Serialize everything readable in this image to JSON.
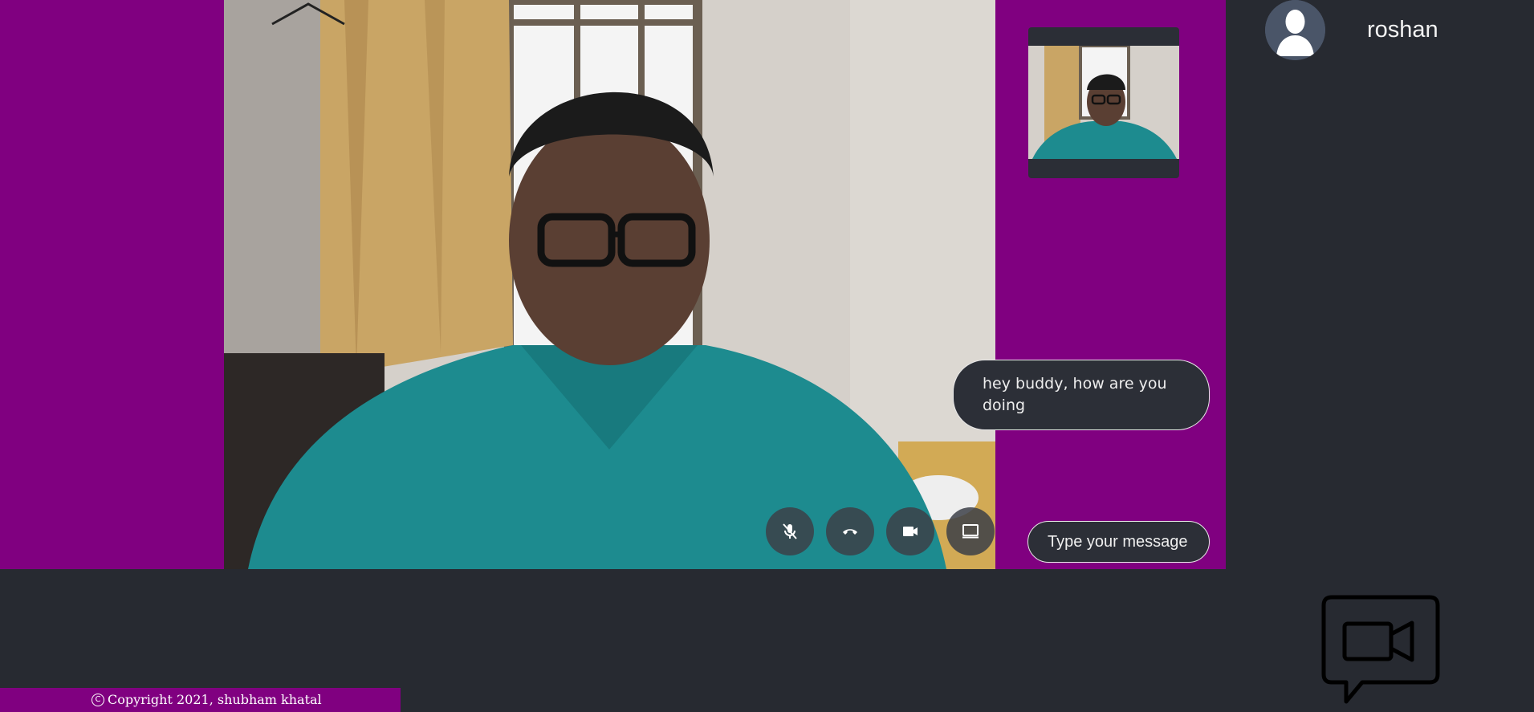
{
  "call": {
    "controls": [
      {
        "name": "mic-off-icon",
        "label": "mute microphone"
      },
      {
        "name": "hang-up-icon",
        "label": "end call"
      },
      {
        "name": "video-camera-icon",
        "label": "toggle camera"
      },
      {
        "name": "screen-share-icon",
        "label": "share screen"
      }
    ]
  },
  "chat": {
    "message": "hey buddy, how are you doing",
    "input_placeholder": "Type your message"
  },
  "contact": {
    "name": "roshan"
  },
  "footer": {
    "copyright": "Copyright 2021, shubham khatal"
  },
  "colors": {
    "stage": "#800080",
    "background": "#272a31",
    "bubble": "#2c2f37"
  }
}
